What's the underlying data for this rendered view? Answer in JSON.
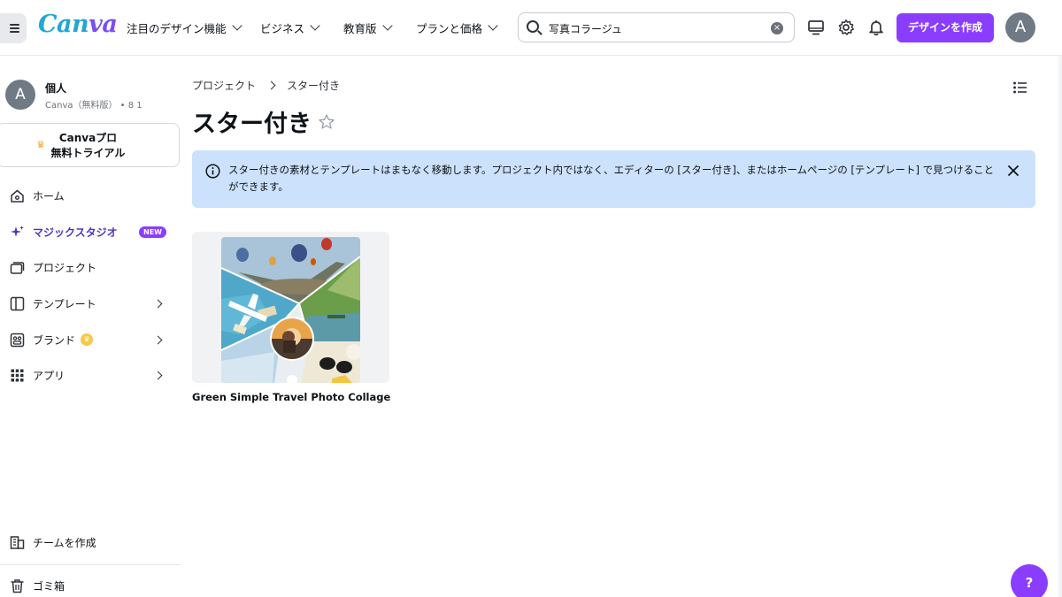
{
  "header": {
    "logo": "Canva",
    "nav": [
      {
        "label": "注目のデザイン機能"
      },
      {
        "label": "ビジネス"
      },
      {
        "label": "教育版"
      },
      {
        "label": "プランと価格"
      }
    ],
    "search": {
      "value": "写真コラージュ",
      "icon": "search-icon"
    },
    "icons": [
      "monitor-icon",
      "gear-icon",
      "bell-icon"
    ],
    "create_button": "デザインを作成",
    "avatar_letter": "A",
    "brand_color": "#8b3dff"
  },
  "sidebar": {
    "account": {
      "avatar_letter": "A",
      "name": "個人",
      "sub": "Canva（無料版） • 8 1"
    },
    "pro_trial": {
      "line1": "Canvaプロ",
      "line2": "無料トライアル"
    },
    "items": [
      {
        "label": "ホーム",
        "icon": "home-icon"
      },
      {
        "label": "マジックスタジオ",
        "icon": "sparkle-icon",
        "badge": "NEW"
      },
      {
        "label": "プロジェクト",
        "icon": "folder-icon"
      },
      {
        "label": "テンプレート",
        "icon": "template-icon"
      },
      {
        "label": "ブランド",
        "icon": "brand-icon"
      },
      {
        "label": "アプリ",
        "icon": "apps-grid-icon"
      }
    ],
    "team": {
      "label": "チームを作成",
      "icon": "team-building-icon"
    },
    "trash": {
      "label": "ゴミ箱",
      "icon": "trash-icon"
    }
  },
  "main": {
    "breadcrumb": [
      "プロジェクト",
      "スター付き"
    ],
    "title": "スター付き",
    "banner": {
      "text": "スター付きの素材とテンプレートはまもなく移動します。プロジェクト内ではなく、エディターの [スター付き]、またはホームページの [テンプレート] で見つけることができます。",
      "bg_color": "#cce1fb"
    },
    "items": [
      {
        "title": "Green Simple Travel Photo Collage"
      }
    ]
  },
  "help": {
    "label": "?"
  }
}
